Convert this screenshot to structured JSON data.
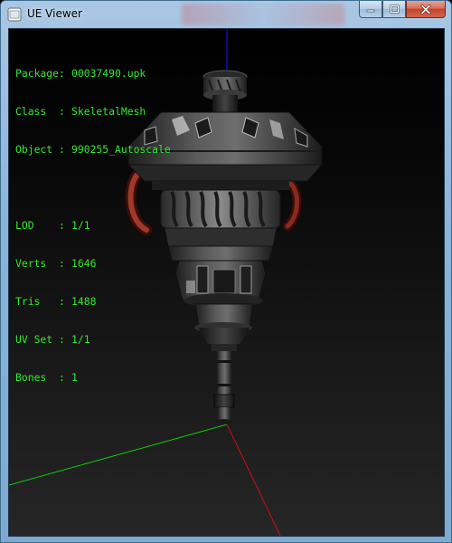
{
  "window": {
    "title": "UE Viewer",
    "icons": {
      "app": "app-icon",
      "minimize": "minimize-icon",
      "maximize": "maximize-icon",
      "close": "close-icon"
    }
  },
  "info": {
    "package": {
      "key": "Package",
      "sep": ":",
      "value": "00037490.upk"
    },
    "class": {
      "key": "Class",
      "sep": ":",
      "value": "SkeletalMesh"
    },
    "object": {
      "key": "Object",
      "sep": ":",
      "value": "990255_Autoscale"
    },
    "lod": {
      "key": "LOD",
      "sep": ":",
      "value": "1/1"
    },
    "verts": {
      "key": "Verts",
      "sep": ":",
      "value": "1646"
    },
    "tris": {
      "key": "Tris",
      "sep": ":",
      "value": "1488"
    },
    "uvset": {
      "key": "UV Set",
      "sep": ":",
      "value": "1/1"
    },
    "bones": {
      "key": "Bones",
      "sep": ":",
      "value": "1"
    }
  },
  "colors": {
    "info_text": "#33e833",
    "axis_x": "#cc1111",
    "axis_y": "#11cc11",
    "axis_z": "#1111ff",
    "mesh_metal": "#4a4a4a",
    "mesh_accent": "#8a2a1e"
  }
}
